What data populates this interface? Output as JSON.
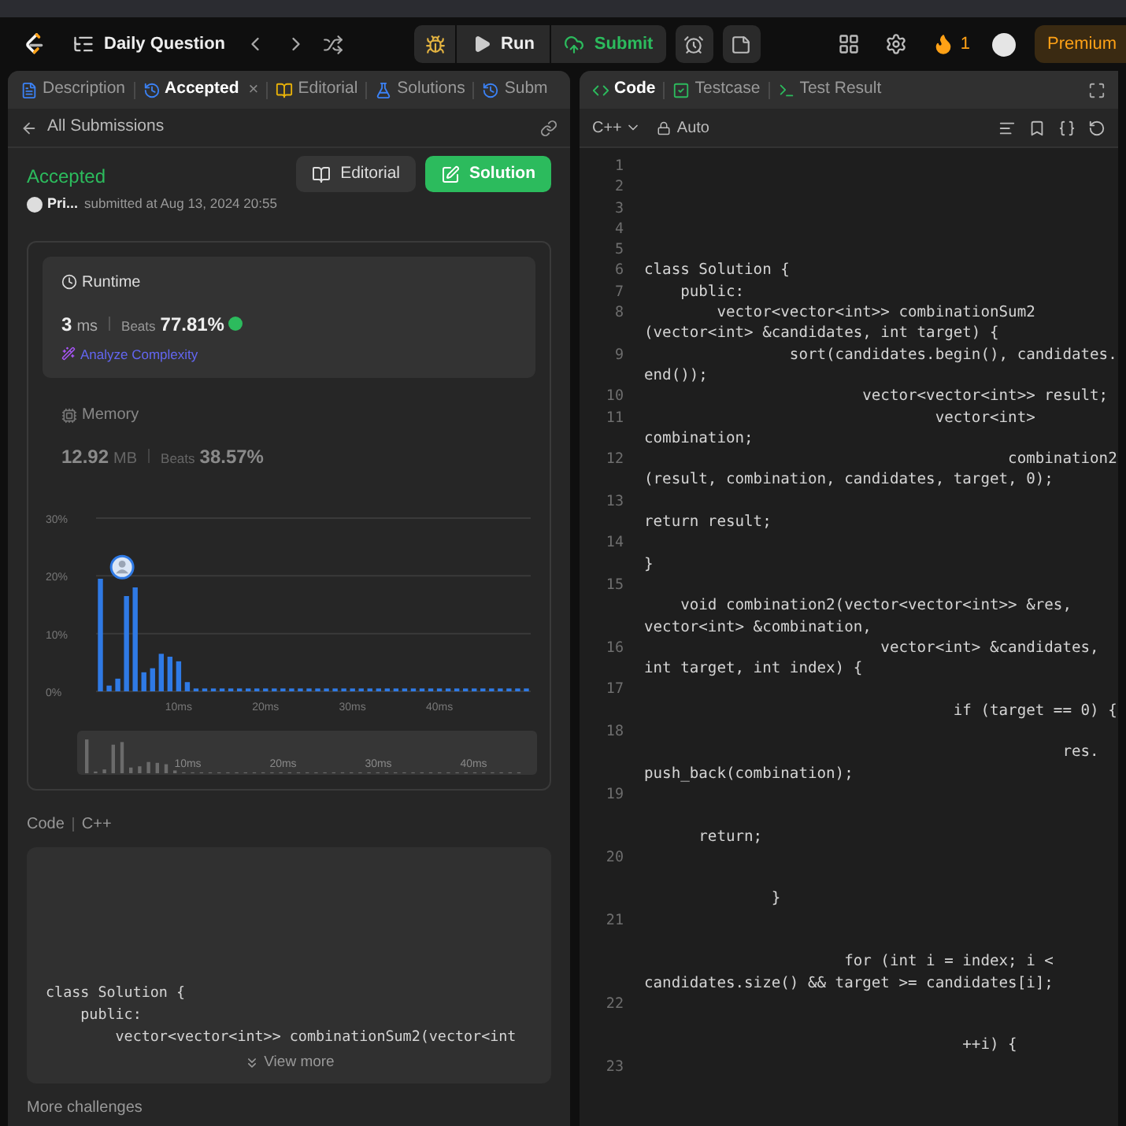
{
  "top_bar": {
    "title": "Daily Question",
    "run": "Run",
    "submit": "Submit",
    "streak": "1",
    "premium": "Premium"
  },
  "left_panel": {
    "tabs": [
      {
        "label": "Description",
        "selected": false
      },
      {
        "label": "Accepted",
        "selected": true,
        "close": "×"
      },
      {
        "label": "Editorial",
        "selected": false
      },
      {
        "label": "Solutions",
        "selected": false
      },
      {
        "label": "Subm",
        "selected": false
      }
    ],
    "back_link": "All Submissions",
    "status": "Accepted",
    "author": "Pri...",
    "submitted": "submitted at Aug 13, 2024 20:55",
    "editorial_button": "Editorial",
    "solution_button": "Solution",
    "runtime": {
      "title": "Runtime",
      "value": "3",
      "unit": "ms",
      "beats_label": "Beats",
      "beats": "77.81%",
      "analyze": "Analyze Complexity"
    },
    "memory": {
      "title": "Memory",
      "value": "12.92",
      "unit": "MB",
      "beats_label": "Beats",
      "beats": "38.57%"
    },
    "chart_data": {
      "type": "bar",
      "x": [
        1,
        2,
        3,
        4,
        5,
        6,
        7,
        8,
        9,
        10,
        11,
        12,
        13,
        14,
        15,
        16,
        17,
        18,
        19,
        20,
        21,
        22,
        23,
        24,
        25,
        26,
        27,
        28,
        29,
        30,
        31,
        32,
        33,
        34,
        35,
        36,
        37,
        38,
        39,
        40,
        41,
        42,
        43,
        44,
        45,
        46,
        47,
        48,
        49,
        50
      ],
      "values": [
        19.5,
        1,
        2.2,
        16.5,
        18,
        3.3,
        4,
        6.5,
        6,
        5.2,
        1.6,
        0.5,
        0.5,
        0.5,
        0.5,
        0.5,
        0.5,
        0.5,
        0.5,
        0.5,
        0.5,
        0.5,
        0.5,
        0.5,
        0.5,
        0.5,
        0.5,
        0.5,
        0.5,
        0.5,
        0.5,
        0.5,
        0.5,
        0.5,
        0.5,
        0.5,
        0.5,
        0.5,
        0.5,
        0.5,
        0.5,
        0.5,
        0.5,
        0.5,
        0.5,
        0.5,
        0.5,
        0.5,
        0.5,
        0.5
      ],
      "xlim": [
        0.5,
        50.5
      ],
      "ylim": [
        0,
        30
      ],
      "yticks": [
        {
          "value": 0,
          "label": "0%"
        },
        {
          "value": 10,
          "label": "10%"
        },
        {
          "value": 20,
          "label": "20%"
        },
        {
          "value": 30,
          "label": "30%"
        }
      ],
      "xticks": [
        {
          "value": 10,
          "label": "10ms"
        },
        {
          "value": 20,
          "label": "20ms"
        },
        {
          "value": 30,
          "label": "30ms"
        },
        {
          "value": 40,
          "label": "40ms"
        }
      ]
    },
    "navigator_labels": [
      "10ms",
      "20ms",
      "30ms",
      "40ms"
    ],
    "code_label": "Code",
    "code_language": "C++",
    "code_preview": [
      "class Solution {",
      "    public:",
      "        vector<vector<int>> combinationSum2(vector<int"
    ],
    "view_more": "View more",
    "more_challenges": "More challenges"
  },
  "right_panel": {
    "tabs": [
      {
        "label": "Code",
        "selected": true
      },
      {
        "label": "Testcase",
        "selected": false
      },
      {
        "label": "Test Result",
        "selected": false
      }
    ],
    "language": "C++",
    "mode": "Auto",
    "lines": [
      {
        "number": "1"
      },
      {
        "number": "2"
      },
      {
        "number": "3"
      },
      {
        "number": "4"
      },
      {
        "number": "5"
      },
      {
        "number": "6",
        "text": "class Solution {"
      },
      {
        "number": "7",
        "text": "    public:"
      },
      {
        "number": "8",
        "text": "        vector<vector<int>> combinationSum2\n(vector<int> &candidates, int target) {"
      },
      {
        "number": "9",
        "text": "                sort(candidates.begin(), candidates.\nend());"
      },
      {
        "number": "10",
        "text": "                        vector<vector<int>> result;"
      },
      {
        "number": "11",
        "text": "                                vector<int>\ncombination;"
      },
      {
        "number": "12",
        "text": "                                        combination2\n(result, combination, candidates, target, 0);"
      },
      {
        "number": "13",
        "text": "\nreturn result;"
      },
      {
        "number": "14",
        "text": "\n}"
      },
      {
        "number": "15",
        "text": "\n    void combination2(vector<vector<int>> &res,\nvector<int> &combination,"
      },
      {
        "number": "16",
        "text": "                          vector<int> &candidates,\nint target, int index) {"
      },
      {
        "number": "17",
        "text": "\n                                  if (target == 0) {"
      },
      {
        "number": "18",
        "text": "\n                                              res.\npush_back(combination);"
      },
      {
        "number": "19",
        "text": "\n\n      return;"
      },
      {
        "number": "20",
        "text": "\n\n              }"
      },
      {
        "number": "21",
        "text": "\n\n                      for (int i = index; i <\ncandidates.size() && target >= candidates[i];"
      },
      {
        "number": "22",
        "text": "\n\n                                   ++i) {"
      },
      {
        "number": "23"
      }
    ]
  }
}
